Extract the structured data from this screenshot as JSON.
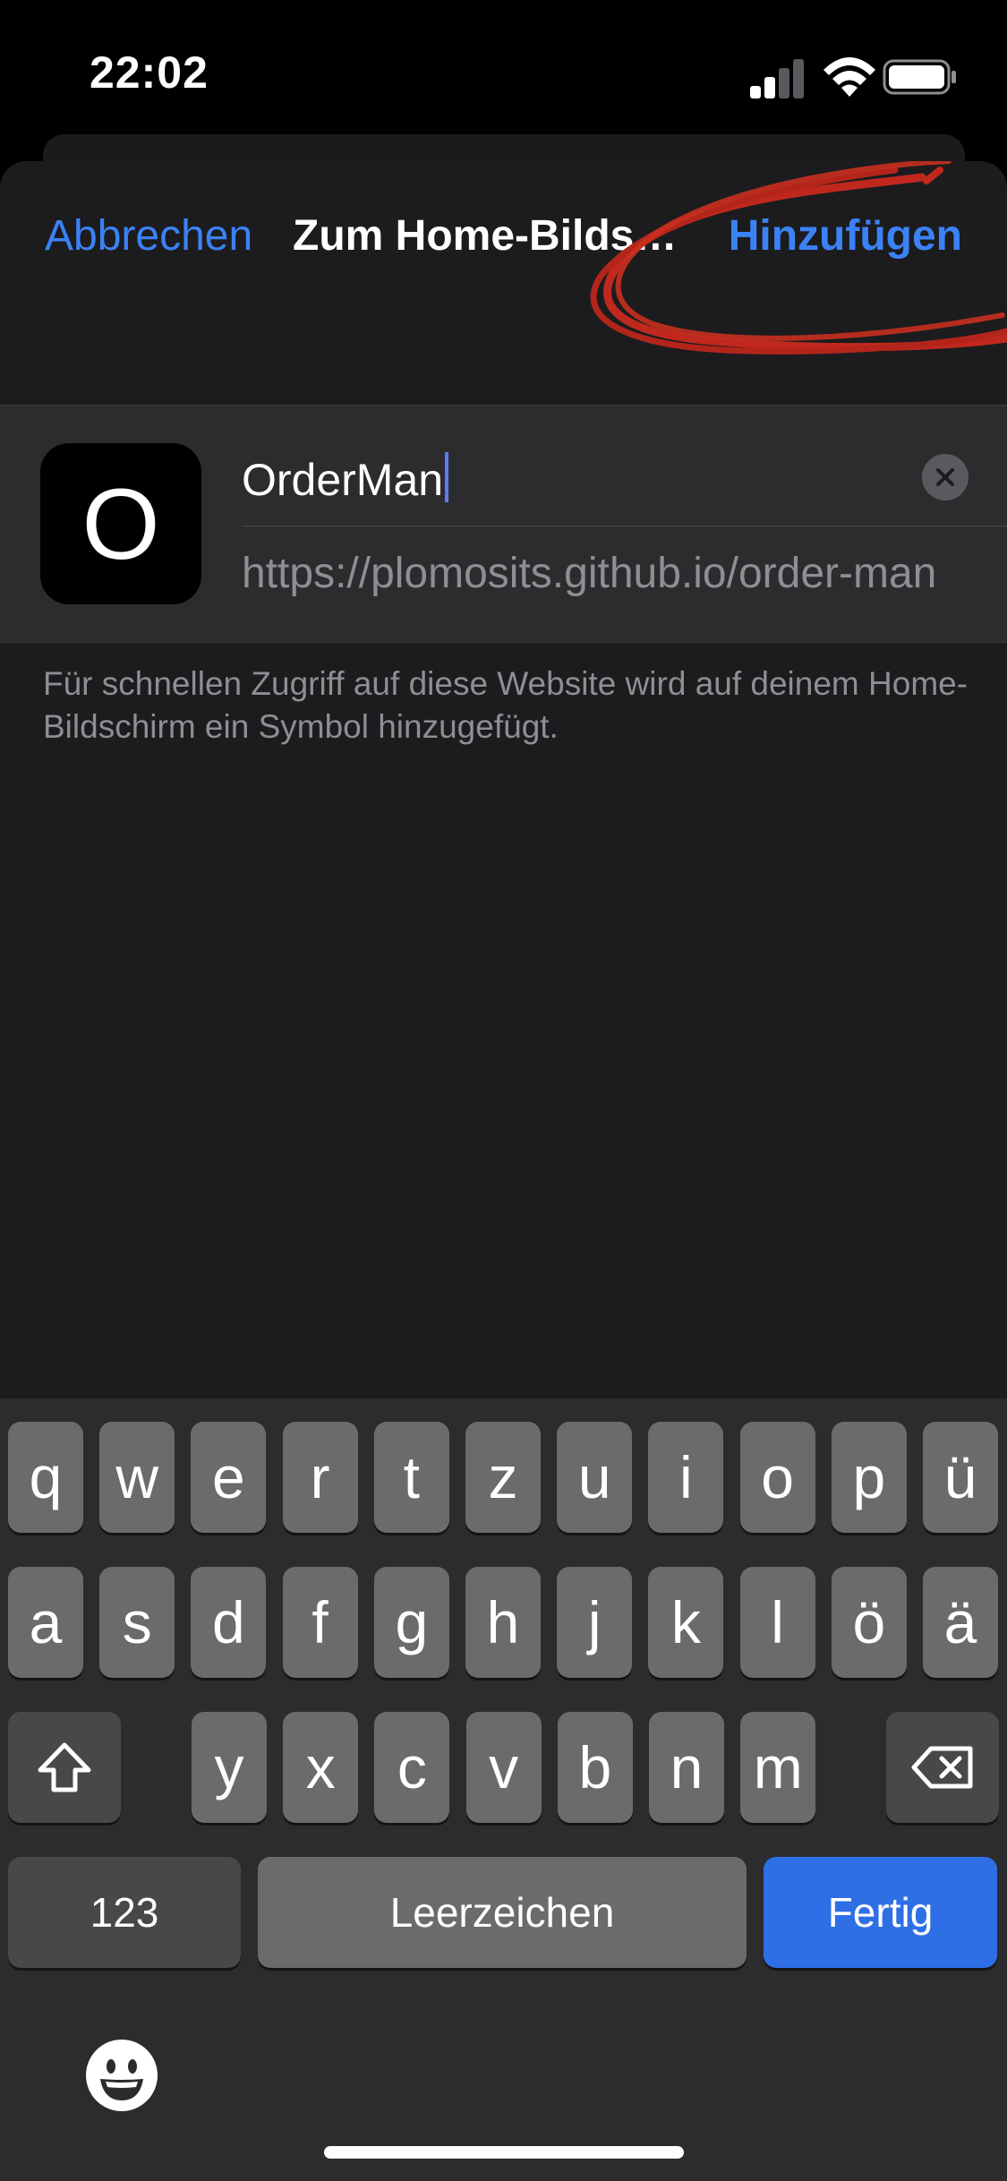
{
  "status_bar": {
    "time": "22:02",
    "signal_icon": "signal-bars-icon",
    "wifi_icon": "wifi-icon",
    "battery_icon": "battery-icon"
  },
  "nav": {
    "cancel_label": "Abbrechen",
    "title": "Zum Home-Bildschirm",
    "add_label": "Hinzufügen"
  },
  "annotation_color": "#c0281e",
  "form": {
    "icon_letter": "O",
    "name_value": "OrderMan",
    "url_value": "https://plomosits.github.io/order-man",
    "clear_icon": "clear-x-icon"
  },
  "hint_text": "Für schnellen Zugriff auf diese Website wird auf deinem Home-Bildschirm ein Symbol hinzugefügt.",
  "keyboard": {
    "row1": [
      "q",
      "w",
      "e",
      "r",
      "t",
      "z",
      "u",
      "i",
      "o",
      "p",
      "ü"
    ],
    "row2": [
      "a",
      "s",
      "d",
      "f",
      "g",
      "h",
      "j",
      "k",
      "l",
      "ö",
      "ä"
    ],
    "row3": [
      "y",
      "x",
      "c",
      "v",
      "b",
      "n",
      "m"
    ],
    "shift_icon": "shift-icon",
    "backspace_icon": "backspace-icon",
    "numbers_label": "123",
    "space_label": "Leerzeichen",
    "done_label": "Fertig",
    "emoji_icon": "emoji-icon",
    "accent_color": "#2f6fe6"
  }
}
